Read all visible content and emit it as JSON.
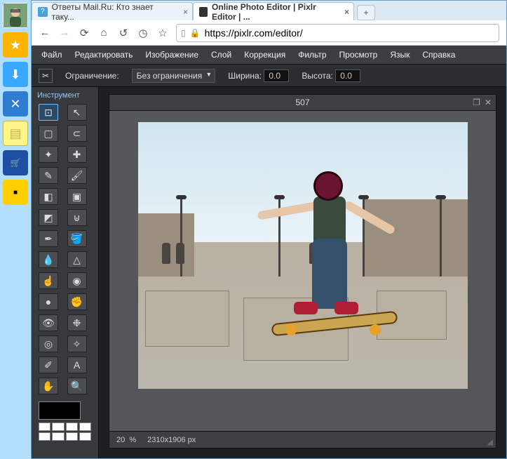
{
  "browser": {
    "tabs": [
      {
        "title": "Ответы Mail.Ru: Кто знает таку...",
        "favicon_bg": "#4aa3e0"
      },
      {
        "title": "Online Photo Editor | Pixlr Editor | ...",
        "favicon_bg": "#333"
      }
    ],
    "url": "https://pixlr.com/editor/"
  },
  "dock": {
    "items": [
      "avatar",
      "star",
      "download",
      "tools",
      "notes",
      "market",
      "taxi"
    ],
    "market_label": "Маркет",
    "taxi_label": "Такси"
  },
  "menu": [
    "Файл",
    "Редактировать",
    "Изображение",
    "Слой",
    "Коррекция",
    "Фильтр",
    "Просмотр",
    "Язык",
    "Справка"
  ],
  "options": {
    "constraint_label": "Ограничение:",
    "constraint_value": "Без ограничения",
    "width_label": "Ширина:",
    "width_value": "0.0",
    "height_label": "Высота:",
    "height_value": "0.0"
  },
  "tools_panel": {
    "title": "Инструмент",
    "tools": [
      "crop",
      "move",
      "marquee",
      "lasso",
      "wand",
      "crosshair",
      "pencil",
      "brush",
      "eraser",
      "paint",
      "gradient",
      "stamp",
      "ink",
      "fill",
      "blur",
      "sharpen",
      "smudge",
      "sponge",
      "dodge",
      "burn",
      "redeye",
      "spot",
      "bloat",
      "pinch",
      "colorpick",
      "type",
      "hand",
      "zoom"
    ],
    "active": "crop"
  },
  "canvas": {
    "title": "507",
    "zoom": "20",
    "zoom_unit": "%",
    "dimensions": "2310x1906 px",
    "image_desc": "skateboarder mid-air trick in city plaza"
  },
  "swatches": {
    "main": "#000000",
    "grid": [
      "#fff",
      "#fff",
      "#fff",
      "#fff",
      "#fff",
      "#fff",
      "#fff",
      "#fff"
    ]
  }
}
